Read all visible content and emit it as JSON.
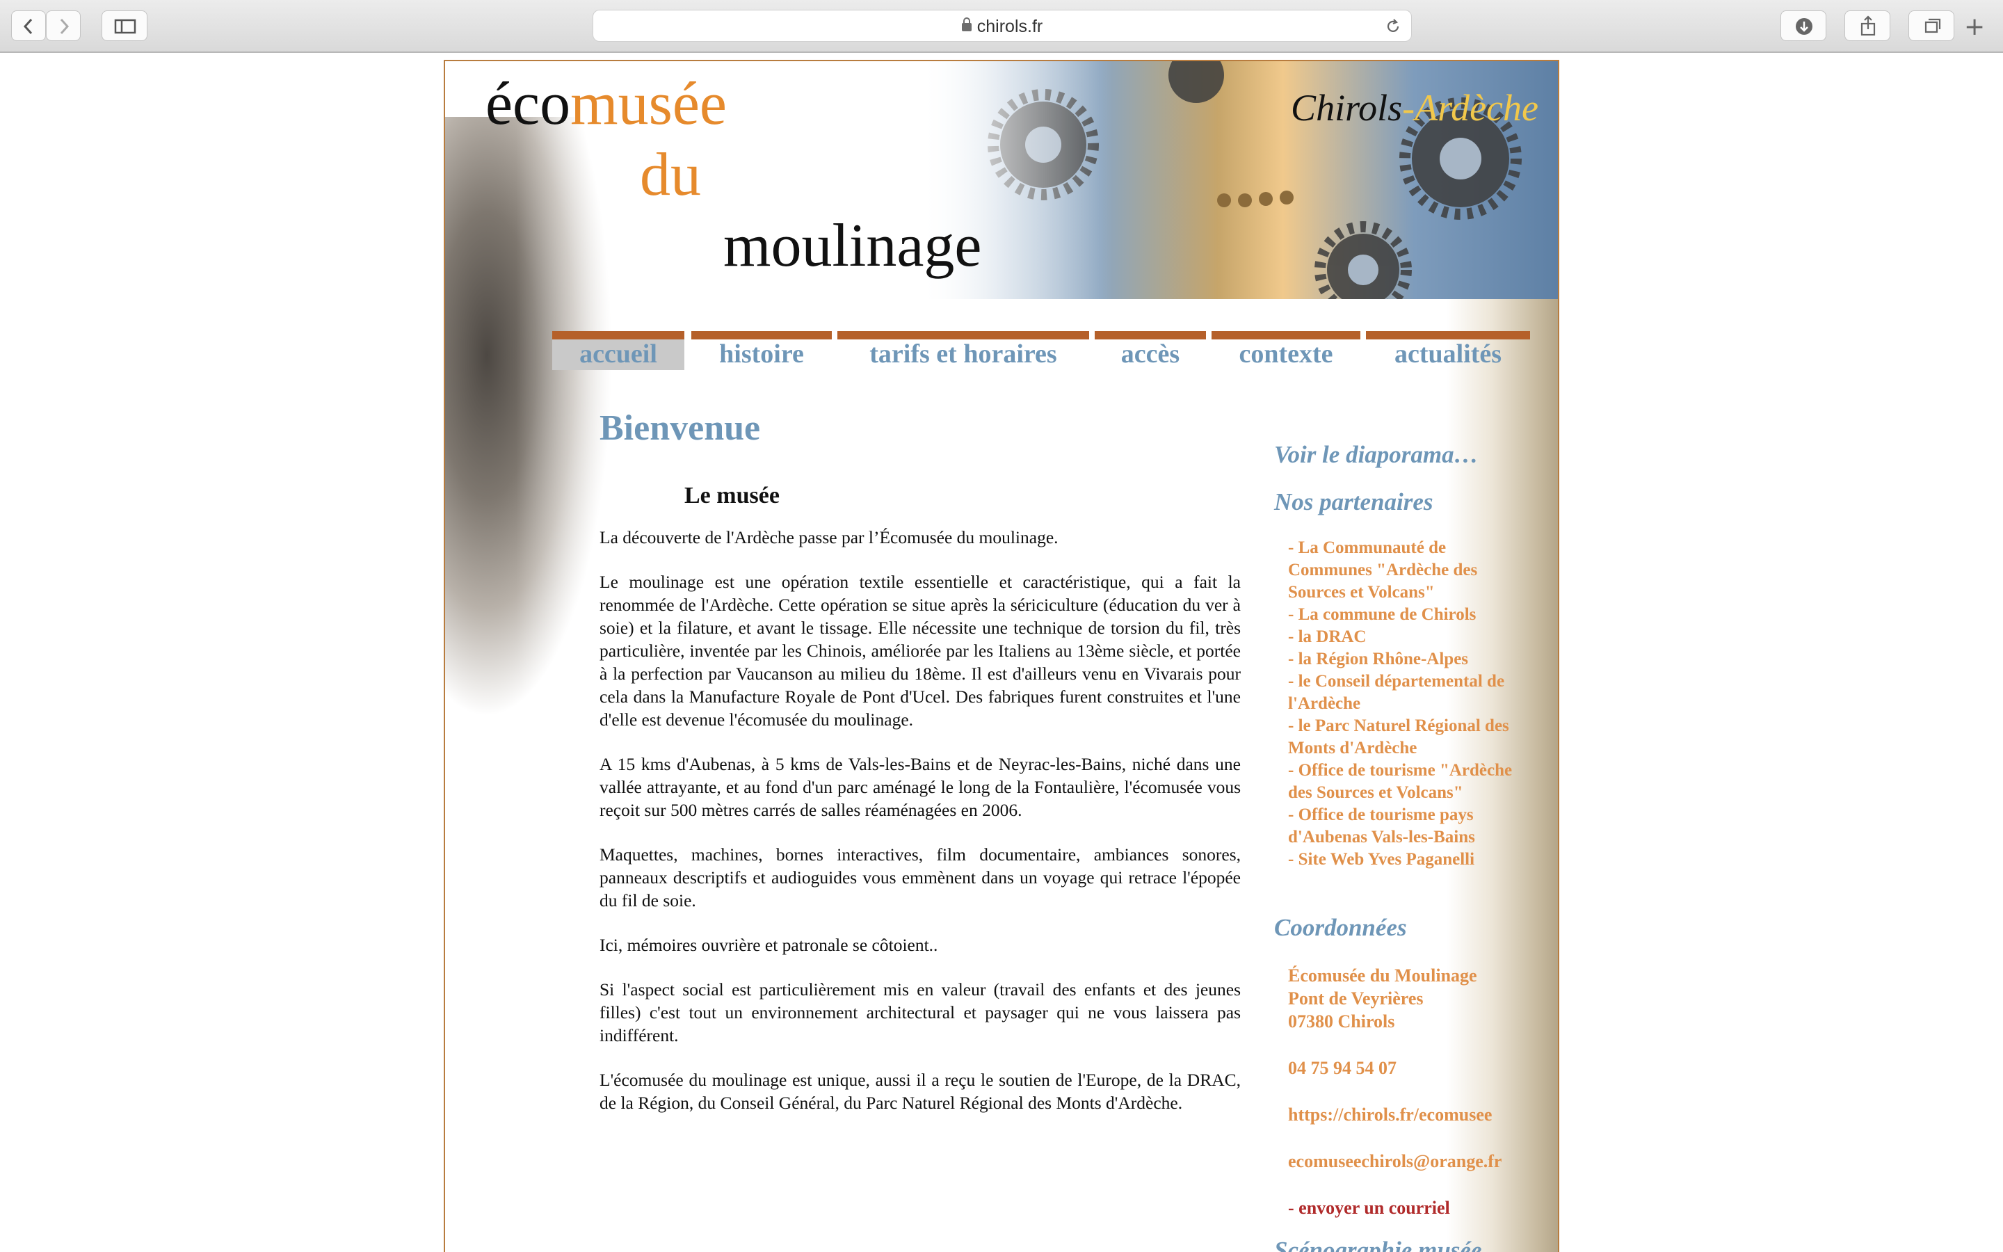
{
  "browser": {
    "url": "chirols.fr"
  },
  "header": {
    "logo_eco": "éco",
    "logo_musee": "musée",
    "logo_du": "du",
    "logo_moulinage": "moulinage",
    "place_a": "Chirols",
    "place_b": "-Ardèche"
  },
  "nav": {
    "items": [
      {
        "label": "accueil",
        "active": true
      },
      {
        "label": "histoire"
      },
      {
        "label": "tarifs et horaires"
      },
      {
        "label": "accès"
      },
      {
        "label": "contexte"
      },
      {
        "label": "actualités"
      }
    ]
  },
  "main": {
    "title": "Bienvenue",
    "subtitle": "Le musée",
    "paragraphs": [
      "La découverte de l'Ardèche passe par l’Écomusée du moulinage.",
      "Le moulinage est une opération textile essentielle et caractéristique, qui a fait la renommée de l'Ardèche. Cette opération se situe après la sériciculture (éducation du ver à soie) et la filature, et avant le tissage. Elle nécessite une technique de torsion du fil, très particulière, inventée par les Chinois, améliorée par les Italiens au 13ème siècle, et portée à la perfection par Vaucanson au milieu du 18ème. Il est d'ailleurs venu en Vivarais pour cela dans la Manufacture Royale de Pont d'Ucel. Des fabriques furent construites et l'une d'elle est devenue l'écomusée du moulinage.",
      "A 15 kms d'Aubenas, à 5 kms de Vals-les-Bains et de Neyrac-les-Bains, niché dans une vallée attrayante, et au fond d'un parc aménagé le long de la Fontaulière, l'écomusée vous reçoit sur 500 mètres carrés de salles réaménagées en 2006.",
      "Maquettes, machines, bornes interactives, film documentaire, ambiances sonores, panneaux descriptifs et audioguides vous emmènent dans un voyage qui retrace l'épopée du fil de soie.",
      "Ici, mémoires ouvrière et patronale se côtoient..",
      "Si l'aspect social est particulièrement mis en valeur (travail des enfants et des jeunes filles) c'est tout un environnement architectural et paysager qui ne vous laissera pas indifférent.",
      "L'écomusée du moulinage est unique, aussi il a reçu le soutien de l'Europe, de la DRAC, de la Région, du Conseil Général, du Parc Naturel Régional des Monts d'Ardèche."
    ]
  },
  "sidebar": {
    "diaporama": "Voir le diaporama…",
    "partners_title": "Nos partenaires",
    "partners": [
      "- La Communauté de Communes \"Ardèche des Sources et Volcans\"",
      "- La commune de Chirols",
      "- la DRAC",
      "- la Région Rhône-Alpes",
      "- le Conseil départemental de l'Ardèche",
      "- le Parc Naturel Régional des Monts d'Ardèche",
      "- Office de tourisme \"Ardèche des Sources et Volcans\"",
      "- Office de tourisme pays d'Aubenas Vals-les-Bains",
      "- Site Web Yves Paganelli"
    ],
    "coords_title": "Coordonnées",
    "address_1": "Écomusée du Moulinage",
    "address_2": "Pont de Veyrières",
    "address_3": "07380 Chirols",
    "phone": "04 75 94 54 07",
    "website": "https://chirols.fr/ecomusee",
    "email": "ecomuseechirols@orange.fr",
    "send_mail": "- envoyer un courriel",
    "next_title": "Scénographie musée"
  },
  "colors": {
    "accent_orange": "#e68a2c",
    "nav_blue": "#6e96b7",
    "nav_bar": "#b5602a",
    "link_orange": "#e0904a",
    "mail_red": "#b02a2a"
  }
}
